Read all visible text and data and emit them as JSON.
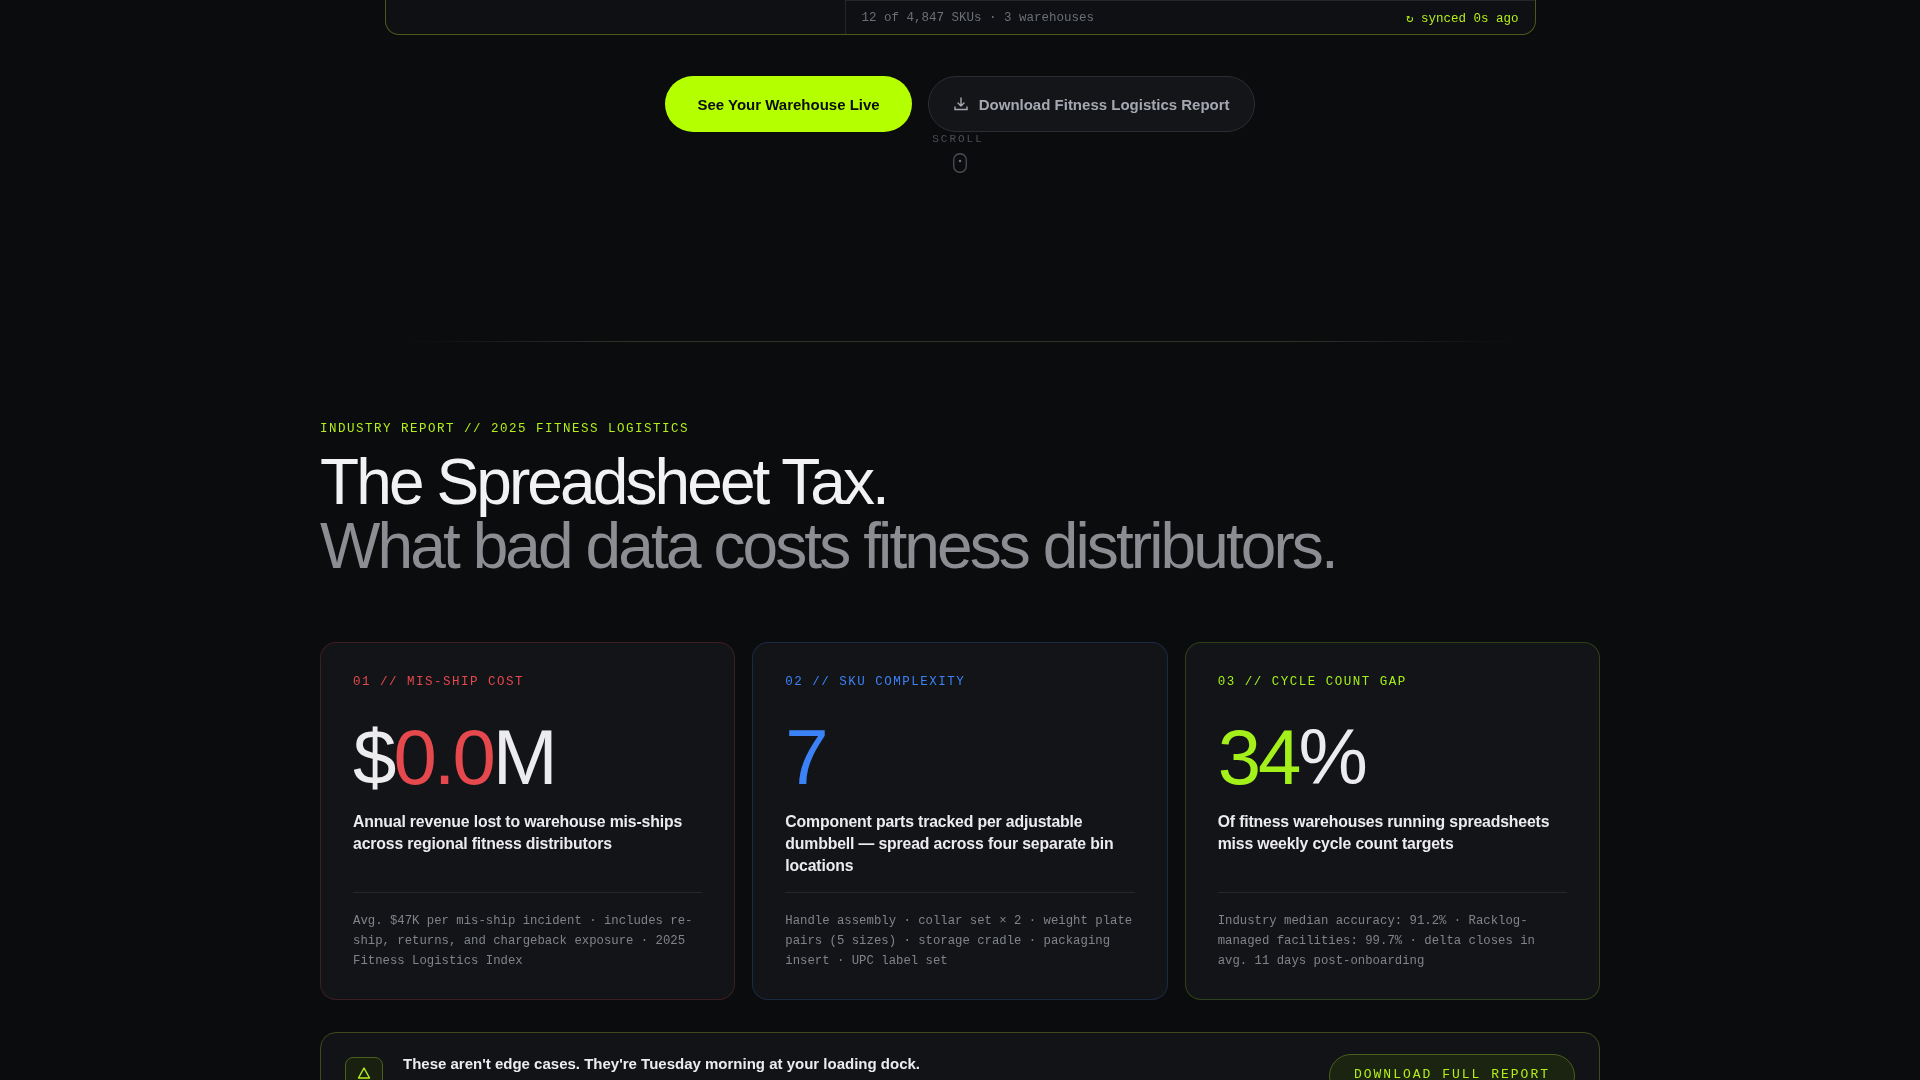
{
  "top_panel": {
    "status": "12 of 4,847 SKUs · 3 warehouses",
    "sync": "↻ synced 0s ago"
  },
  "actions": [
    {
      "kind": "primary",
      "label": "See Your Warehouse Live"
    },
    {
      "kind": "secondary",
      "label": "Download Fitness Logistics Report"
    }
  ],
  "scroll_hint": "SCROLL",
  "section": {
    "eyebrow": "INDUSTRY REPORT // 2025 FITNESS LOGISTICS",
    "title": "The Spreadsheet Tax.",
    "subtitle": "What bad data costs fitness distributors."
  },
  "cards": [
    {
      "label": "01 // MIS-SHIP COST",
      "color": "#e5484d",
      "value_parts": [
        {
          "text": "$",
          "accent": false
        },
        {
          "text": "0.0",
          "accent": true
        },
        {
          "text": "M",
          "accent": false
        }
      ],
      "description": "Annual revenue lost to warehouse mis-ships across regional fitness distributors",
      "footnote": "Avg. $47K per mis-ship incident · includes re-ship, returns, and chargeback exposure · 2025 Fitness Logistics Index"
    },
    {
      "label": "02 // SKU COMPLEXITY",
      "color": "#3b82f6",
      "value_parts": [
        {
          "text": "7",
          "accent": true
        }
      ],
      "description": "Component parts tracked per adjustable dumbbell — spread across four separate bin locations",
      "footnote": "Handle assembly · collar set × 2 · weight plate pairs (5 sizes) · storage cradle · packaging insert · UPC label set"
    },
    {
      "label": "03 // CYCLE COUNT GAP",
      "color": "#a3f01a",
      "value_parts": [
        {
          "text": "34",
          "accent": true
        },
        {
          "text": "%",
          "accent": false
        }
      ],
      "description": "Of fitness warehouses running spreadsheets miss weekly cycle count targets",
      "footnote": "Industry median accuracy: 91.2% · Racklog-managed facilities: 99.7% · delta closes in avg. 11 days post-onboarding"
    }
  ],
  "banner": {
    "message": "These aren't edge cases. They're Tuesday morning at your loading dock.",
    "button": "DOWNLOAD FULL REPORT"
  }
}
